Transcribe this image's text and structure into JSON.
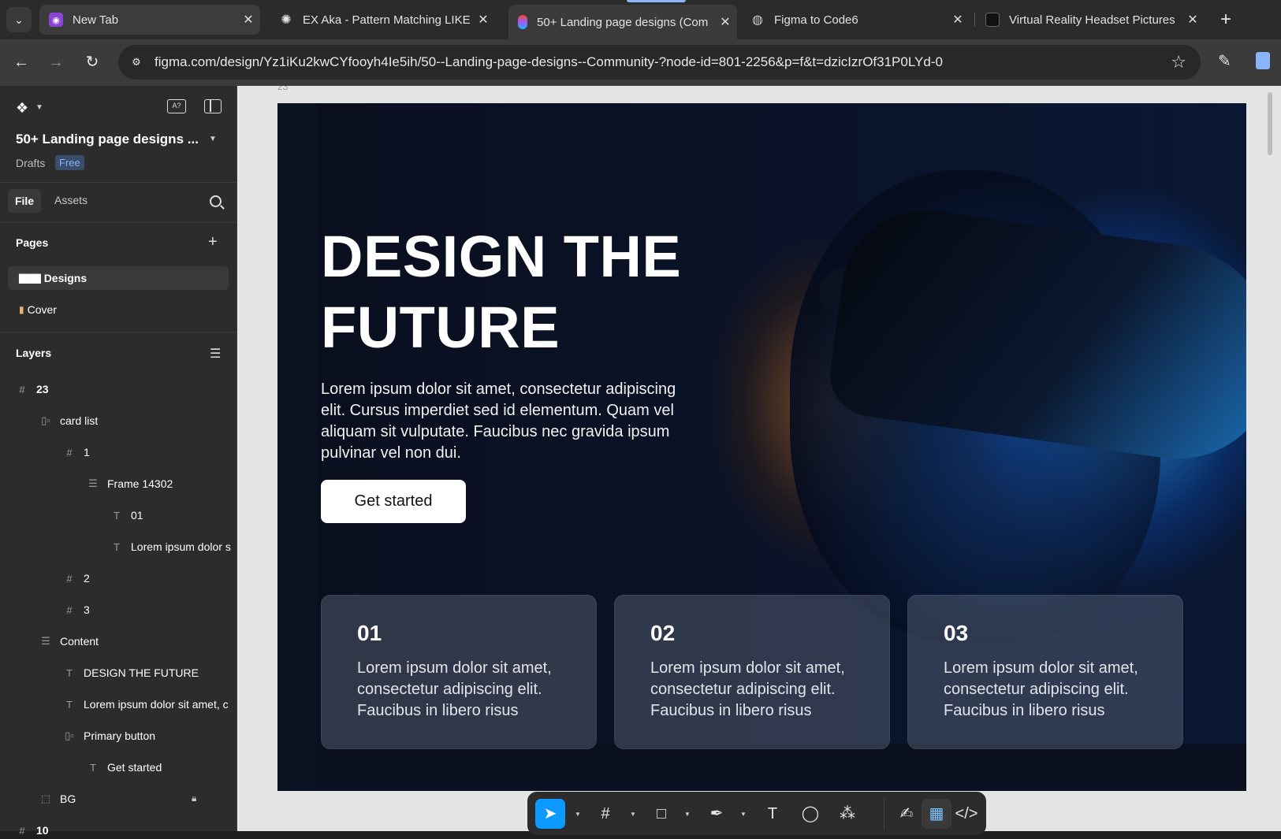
{
  "browser": {
    "tabs": [
      {
        "title": "New Tab"
      },
      {
        "title": "EX Aka - Pattern Matching LIKE"
      },
      {
        "title": "50+ Landing page designs (Com"
      },
      {
        "title": "Figma to Code6"
      },
      {
        "title": "Virtual Reality Headset Pictures"
      }
    ],
    "url": "figma.com/design/Yz1iKu2kwCYfooyh4Ie5ih/50--Landing-page-designs--Community-?node-id=801-2256&p=f&t=dzicIzrOf31P0LYd-0"
  },
  "figma": {
    "file_title": "50+ Landing page designs ...",
    "drafts": "Drafts",
    "plan_badge": "Free",
    "panel_tabs": {
      "file": "File",
      "assets": "Assets"
    },
    "pages_label": "Pages",
    "pages": [
      {
        "label": "Designs",
        "emoji": "▇▇▇"
      },
      {
        "label": "Cover",
        "emoji": "▮"
      }
    ],
    "layers_label": "Layers",
    "layers": [
      {
        "name": "23",
        "icon": "#"
      },
      {
        "name": "card list",
        "icon": "▯▫"
      },
      {
        "name": "1",
        "icon": "#"
      },
      {
        "name": "Frame 14302",
        "icon": "☰"
      },
      {
        "name": "01",
        "icon": "T"
      },
      {
        "name": "Lorem ipsum dolor s",
        "icon": "T"
      },
      {
        "name": "2",
        "icon": "#"
      },
      {
        "name": "3",
        "icon": "#"
      },
      {
        "name": "Content",
        "icon": "☰"
      },
      {
        "name": "DESIGN THE FUTURE",
        "icon": "T"
      },
      {
        "name": "Lorem ipsum dolor sit amet, c",
        "icon": "T"
      },
      {
        "name": "Primary button",
        "icon": "▯▫"
      },
      {
        "name": "Get started",
        "icon": "T"
      },
      {
        "name": "BG",
        "icon": "⬚"
      },
      {
        "name": "10",
        "icon": "#"
      }
    ]
  },
  "canvas": {
    "frame_label": "23",
    "hero_title_line1": "DESIGN THE",
    "hero_title_line2": "FUTURE",
    "hero_body": "Lorem ipsum dolor sit amet, consectetur adipiscing elit. Cursus imperdiet sed id elementum. Quam vel aliquam sit vulputate. Faucibus nec gravida ipsum pulvinar vel non dui.",
    "cta_label": "Get started",
    "cards": [
      {
        "number": "01",
        "text": "Lorem ipsum dolor sit amet, consectetur adipiscing elit. Faucibus in libero risus"
      },
      {
        "number": "02",
        "text": "Lorem ipsum dolor sit amet, consectetur adipiscing elit. Faucibus in libero risus"
      },
      {
        "number": "03",
        "text": "Lorem ipsum dolor sit amet, consectetur adipiscing elit. Faucibus in libero risus"
      }
    ]
  },
  "icons": {
    "tab_menu": "chevron-down-icon",
    "back": "arrow-left-icon",
    "forward": "arrow-right-icon",
    "reload": "reload-icon",
    "site_info": "tune-icon",
    "bookmark": "star-icon",
    "figma": "figma-logo-icon",
    "move_tool": "cursor-icon",
    "frame_tool": "frame-icon",
    "shape_tool": "rectangle-icon",
    "pen_tool": "pen-icon",
    "text_tool": "text-icon",
    "comment_tool": "comment-icon",
    "actions_tool": "actions-icon",
    "draw_mode": "draw-icon",
    "design_mode": "design-icon",
    "dev_mode": "code-icon"
  },
  "colors": {
    "accent": "#0d99ff",
    "panel_bg": "#2c2c2c",
    "canvas_bg": "#e5e5e5",
    "hero_bg": "#0a1020"
  }
}
